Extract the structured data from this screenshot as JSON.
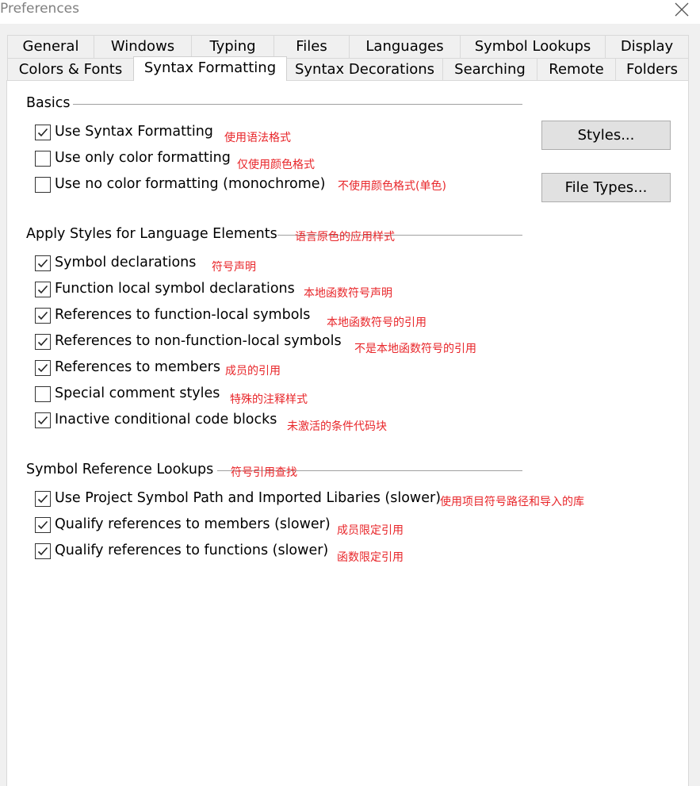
{
  "window": {
    "title": "Preferences"
  },
  "tabs_row1": [
    "General",
    "Windows",
    "Typing",
    "Files",
    "Languages",
    "Symbol Lookups",
    "Display"
  ],
  "tabs_row2": [
    "Colors & Fonts",
    "Syntax Formatting",
    "Syntax Decorations",
    "Searching",
    "Remote",
    "Folders"
  ],
  "active_tab": "Syntax Formatting",
  "basics": {
    "header": "Basics",
    "items": [
      {
        "label": "Use Syntax Formatting",
        "checked": true,
        "note": "使用语法格式"
      },
      {
        "label": "Use only color formatting",
        "checked": false,
        "note": "仅使用颜色格式"
      },
      {
        "label": "Use no color formatting (monochrome)",
        "checked": false,
        "note": "不使用颜色格式(单色)"
      }
    ]
  },
  "buttons": {
    "styles": "Styles...",
    "file_types": "File Types..."
  },
  "apply_styles": {
    "header": "Apply Styles for Language Elements",
    "header_note": "语言原色的应用样式",
    "items": [
      {
        "label": "Symbol declarations",
        "checked": true,
        "note": "符号声明"
      },
      {
        "label": "Function local symbol declarations",
        "checked": true,
        "note": "本地函数符号声明"
      },
      {
        "label": "References to function-local symbols",
        "checked": true,
        "note": "本地函数符号的引用"
      },
      {
        "label": "References to non-function-local symbols",
        "checked": true,
        "note": "不是本地函数符号的引用"
      },
      {
        "label": "References to members",
        "checked": true,
        "note": "成员的引用"
      },
      {
        "label": "Special comment styles",
        "checked": false,
        "note": "特殊的注释样式"
      },
      {
        "label": "Inactive conditional code blocks",
        "checked": true,
        "note": "未激活的条件代码块"
      }
    ]
  },
  "symbol_lookups": {
    "header": "Symbol Reference Lookups",
    "header_note": "符号引用查找",
    "items": [
      {
        "label": "Use Project Symbol Path and Imported Libaries (slower)",
        "checked": true,
        "note": "使用项目符号路径和导入的库"
      },
      {
        "label": "Qualify references to members (slower)",
        "checked": true,
        "note": "成员限定引用"
      },
      {
        "label": "Qualify references to functions (slower)",
        "checked": true,
        "note": "函数限定引用"
      }
    ]
  }
}
